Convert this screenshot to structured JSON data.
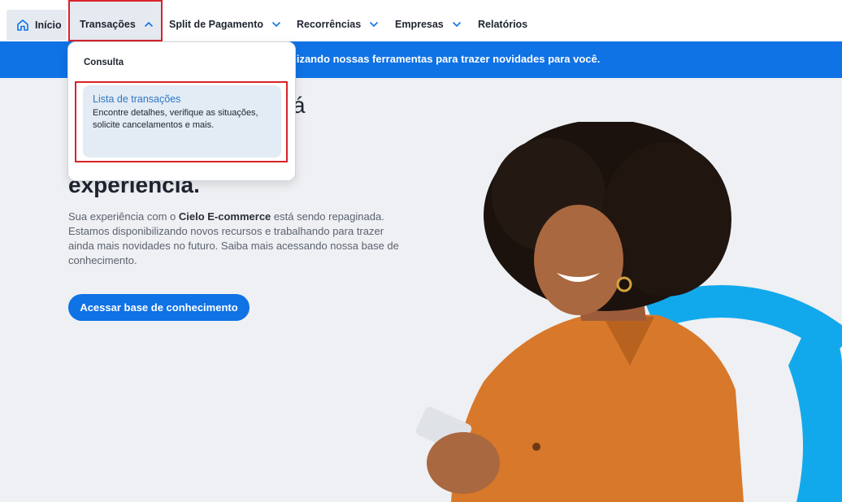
{
  "nav": {
    "home_label": "Início",
    "items": [
      {
        "label": "Transações"
      },
      {
        "label": "Split de Pagamento"
      },
      {
        "label": "Recorrências"
      },
      {
        "label": "Empresas"
      },
      {
        "label": "Relatórios"
      }
    ]
  },
  "banner": {
    "text": "alizando nossas ferramentas para trazer novidades para você."
  },
  "hero": {
    "title_line1_fragment": "á",
    "title_line2": "experiência.",
    "text_prefix": "Sua experiência com o ",
    "text_bold": "Cielo E-commerce",
    "text_suffix": " está sendo repaginada. Estamos disponibilizando novos recursos e trabalhando para trazer ainda mais novidades no futuro. Saiba mais acessando nossa base de conhecimento.",
    "cta_label": "Acessar base de conhecimento"
  },
  "dropdown": {
    "section_label": "Consulta",
    "item_title": "Lista de transações",
    "item_desc": "Encontre detalhes, verifique as situações, solicite cancelamentos e mais."
  },
  "colors": {
    "primary": "#0f72e5",
    "highlight_border": "#d9232a",
    "ring": "#12a9ec"
  },
  "icons": {
    "home": "home-icon",
    "chevron": "chevron-down-icon",
    "chevron_open": "chevron-up-icon"
  }
}
